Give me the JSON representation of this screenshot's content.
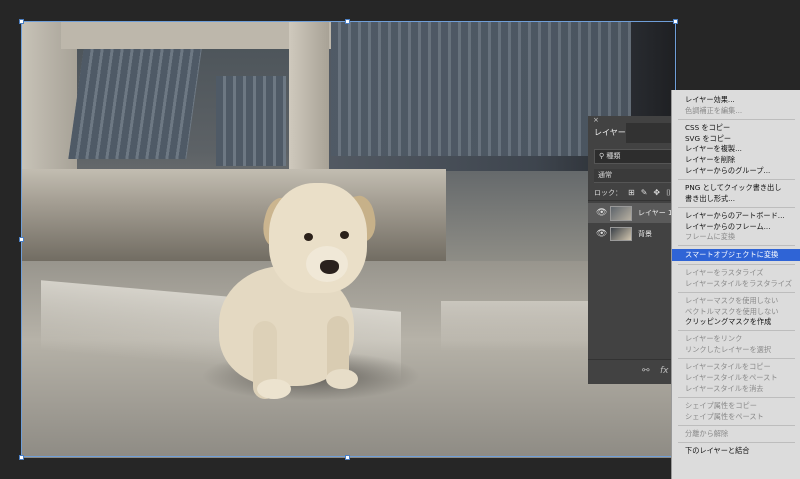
{
  "layers_panel": {
    "close": "×",
    "tab": "レイヤー",
    "filter": "種類",
    "blend_mode": "通常",
    "lock_label": "ロック：",
    "lock_icons": [
      "⊞",
      "✎",
      "✥",
      "⌷"
    ],
    "layers": [
      {
        "visible": "👁",
        "name": "レイヤー 1"
      },
      {
        "visible": "👁",
        "name": "背景"
      }
    ],
    "footer": {
      "link": "⚯",
      "fx": "fx"
    }
  },
  "context_menu": {
    "groups": [
      [
        {
          "label": "レイヤー効果...",
          "enabled": true
        },
        {
          "label": "色調補正を編集...",
          "enabled": false
        }
      ],
      [
        {
          "label": "CSS をコピー",
          "enabled": true
        },
        {
          "label": "SVG をコピー",
          "enabled": true
        },
        {
          "label": "レイヤーを複製...",
          "enabled": true
        },
        {
          "label": "レイヤーを削除",
          "enabled": true
        },
        {
          "label": "レイヤーからのグループ...",
          "enabled": true
        }
      ],
      [
        {
          "label": "PNG としてクイック書き出し",
          "enabled": true
        },
        {
          "label": "書き出し形式...",
          "enabled": true
        }
      ],
      [
        {
          "label": "レイヤーからのアートボード...",
          "enabled": true
        },
        {
          "label": "レイヤーからのフレーム...",
          "enabled": true
        },
        {
          "label": "フレームに変換",
          "enabled": false
        }
      ],
      [
        {
          "label": "スマートオブジェクトに変換",
          "enabled": true,
          "highlighted": true
        }
      ],
      [
        {
          "label": "レイヤーをラスタライズ",
          "enabled": false
        },
        {
          "label": "レイヤースタイルをラスタライズ",
          "enabled": false
        }
      ],
      [
        {
          "label": "レイヤーマスクを使用しない",
          "enabled": false
        },
        {
          "label": "ベクトルマスクを使用しない",
          "enabled": false
        },
        {
          "label": "クリッピングマスクを作成",
          "enabled": true
        }
      ],
      [
        {
          "label": "レイヤーをリンク",
          "enabled": false
        },
        {
          "label": "リンクしたレイヤーを選択",
          "enabled": false
        }
      ],
      [
        {
          "label": "レイヤースタイルをコピー",
          "enabled": false
        },
        {
          "label": "レイヤースタイルをペースト",
          "enabled": false
        },
        {
          "label": "レイヤースタイルを消去",
          "enabled": false
        }
      ],
      [
        {
          "label": "シェイプ属性をコピー",
          "enabled": false
        },
        {
          "label": "シェイプ属性をペースト",
          "enabled": false
        }
      ],
      [
        {
          "label": "分離から解除",
          "enabled": false
        }
      ],
      [
        {
          "label": "下のレイヤーと結合",
          "enabled": true
        }
      ]
    ]
  },
  "colors": {
    "workspace": "#262626",
    "panel": "#424242",
    "menu_bg": "#dcdcdc",
    "highlight": "#2f64d6",
    "selection": "#6f9ed8"
  }
}
